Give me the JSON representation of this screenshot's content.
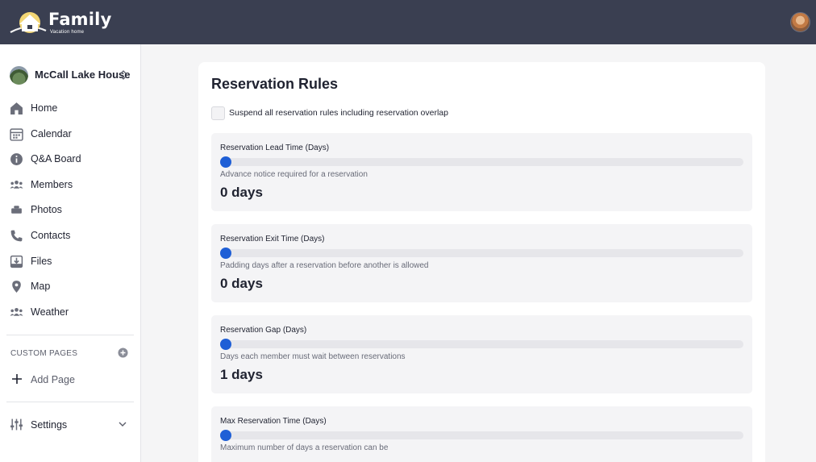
{
  "brand": {
    "title": "Family",
    "subtitle": "Vacation home"
  },
  "sidebar": {
    "house_name": "McCall Lake House",
    "items": [
      {
        "label": "Home",
        "icon": "home-icon"
      },
      {
        "label": "Calendar",
        "icon": "calendar-icon"
      },
      {
        "label": "Q&A Board",
        "icon": "info-icon"
      },
      {
        "label": "Members",
        "icon": "members-icon"
      },
      {
        "label": "Photos",
        "icon": "photos-icon"
      },
      {
        "label": "Contacts",
        "icon": "phone-icon"
      },
      {
        "label": "Files",
        "icon": "files-icon"
      },
      {
        "label": "Map",
        "icon": "map-pin-icon"
      },
      {
        "label": "Weather",
        "icon": "weather-icon"
      }
    ],
    "custom_pages_title": "CUSTOM PAGES",
    "add_page_label": "Add Page",
    "settings_label": "Settings"
  },
  "main": {
    "title": "Reservation Rules",
    "suspend_label": "Suspend all reservation rules including reservation overlap",
    "suspend_checked": false,
    "rules": [
      {
        "title": "Reservation Lead Time (Days)",
        "description": "Advance notice required for a reservation",
        "value_text": "0 days",
        "slider_value": 0
      },
      {
        "title": "Reservation Exit Time (Days)",
        "description": "Padding days after a reservation before another is allowed",
        "value_text": "0 days",
        "slider_value": 0
      },
      {
        "title": "Reservation Gap (Days)",
        "description": "Days each member must wait between reservations",
        "value_text": "1 days",
        "slider_value": 1
      },
      {
        "title": "Max Reservation Time (Days)",
        "description": "Maximum number of days a reservation can be",
        "value_text": "",
        "slider_value": 0
      }
    ]
  },
  "colors": {
    "topbar": "#3a3f51",
    "accent": "#1f5fd6",
    "panel": "#f4f4f6"
  }
}
